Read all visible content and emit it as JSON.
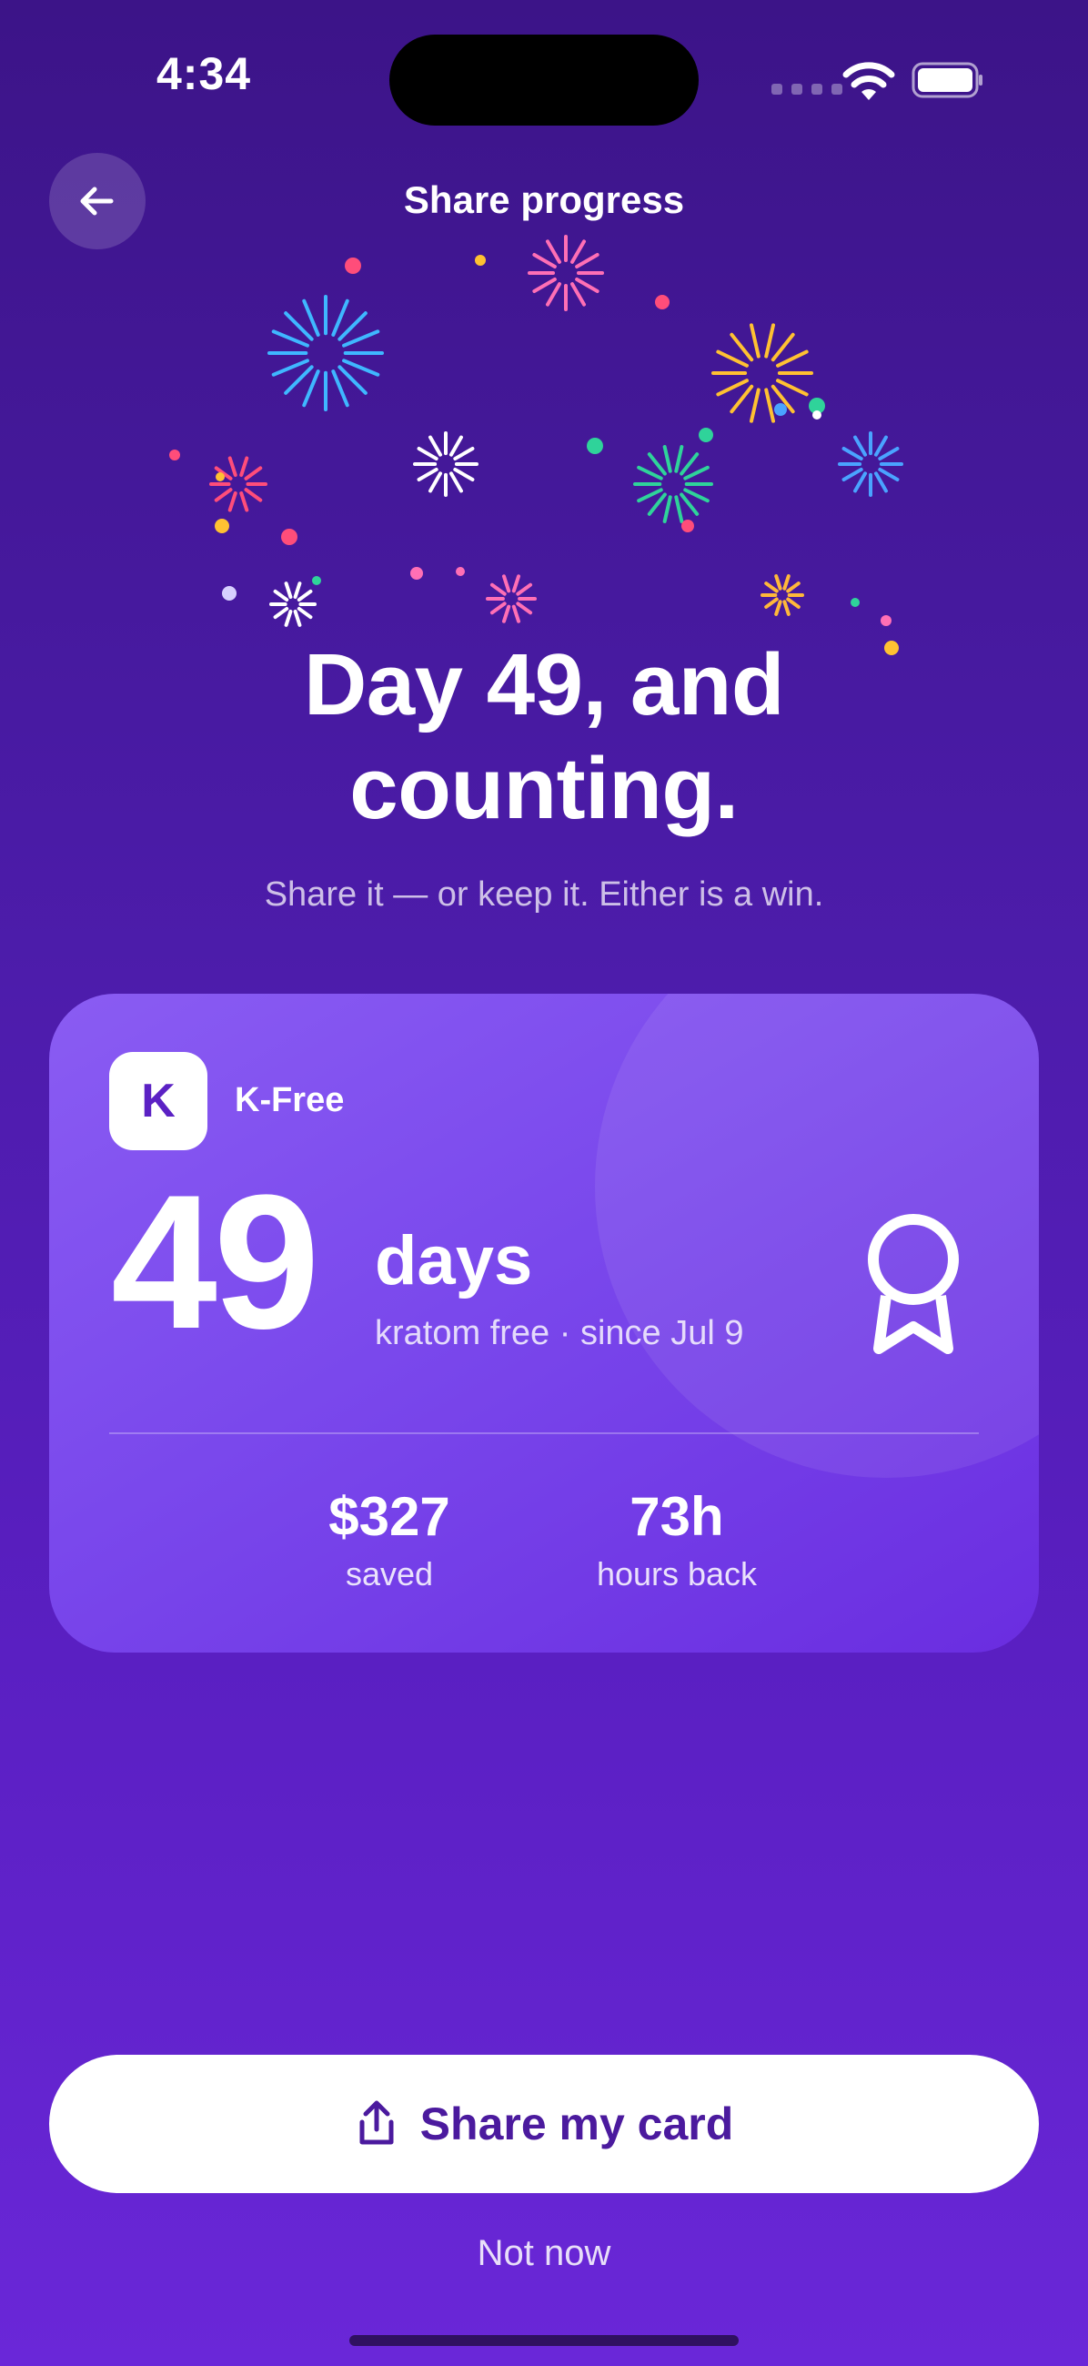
{
  "status_bar": {
    "time": "4:34"
  },
  "header": {
    "title": "Share progress",
    "back_icon": "arrow-left-icon"
  },
  "hero": {
    "headline_line1": "Day 49, and",
    "headline_line2": "counting.",
    "subtitle": "Share it — or keep it. Either is a win."
  },
  "card": {
    "logo_letter": "K",
    "brand": "K-Free",
    "day_count": "49",
    "days_label": "days",
    "since_text": "kratom free · since Jul 9",
    "badge_icon": "award-ribbon-icon",
    "stats": [
      {
        "value": "$327",
        "label": "saved"
      },
      {
        "value": "73h",
        "label": "hours back"
      }
    ]
  },
  "actions": {
    "share_label": "Share my card",
    "share_icon": "share-upload-icon",
    "dismiss_label": "Not now"
  },
  "colors": {
    "background_top": "#3c1488",
    "background_bottom": "#6a27d8",
    "card_accent": "#7a48ec",
    "button_text": "#4b1a9e"
  }
}
